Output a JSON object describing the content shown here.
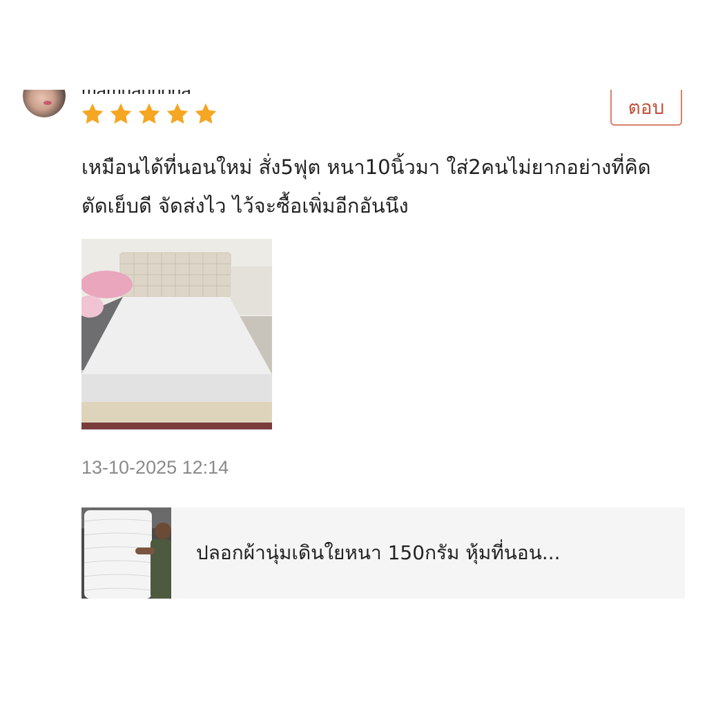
{
  "review": {
    "username": "mamuauriona",
    "rating": 5,
    "rating_max": 5,
    "reply_label": "ตอบ",
    "text": "เหมือนได้ที่นอนใหม่ สั่ง5ฟุต หนา10นิ้วมา ใส่2คนไม่ยากอย่างที่คิด ตัดเย็บดี จัดส่งไว ไว้จะซื้อเพิ่มอีกอันนึง",
    "timestamp": "13-10-2025 12:14"
  },
  "product": {
    "name": "ปลอกผ้านุ่มเดินใยหนา 150กรัม หุ้มที่นอน..."
  },
  "colors": {
    "star": "#f5a623",
    "reply_border": "#d8826a",
    "reply_text": "#c0533a",
    "timestamp": "#8a8a8a",
    "card_bg": "#f5f5f5"
  }
}
